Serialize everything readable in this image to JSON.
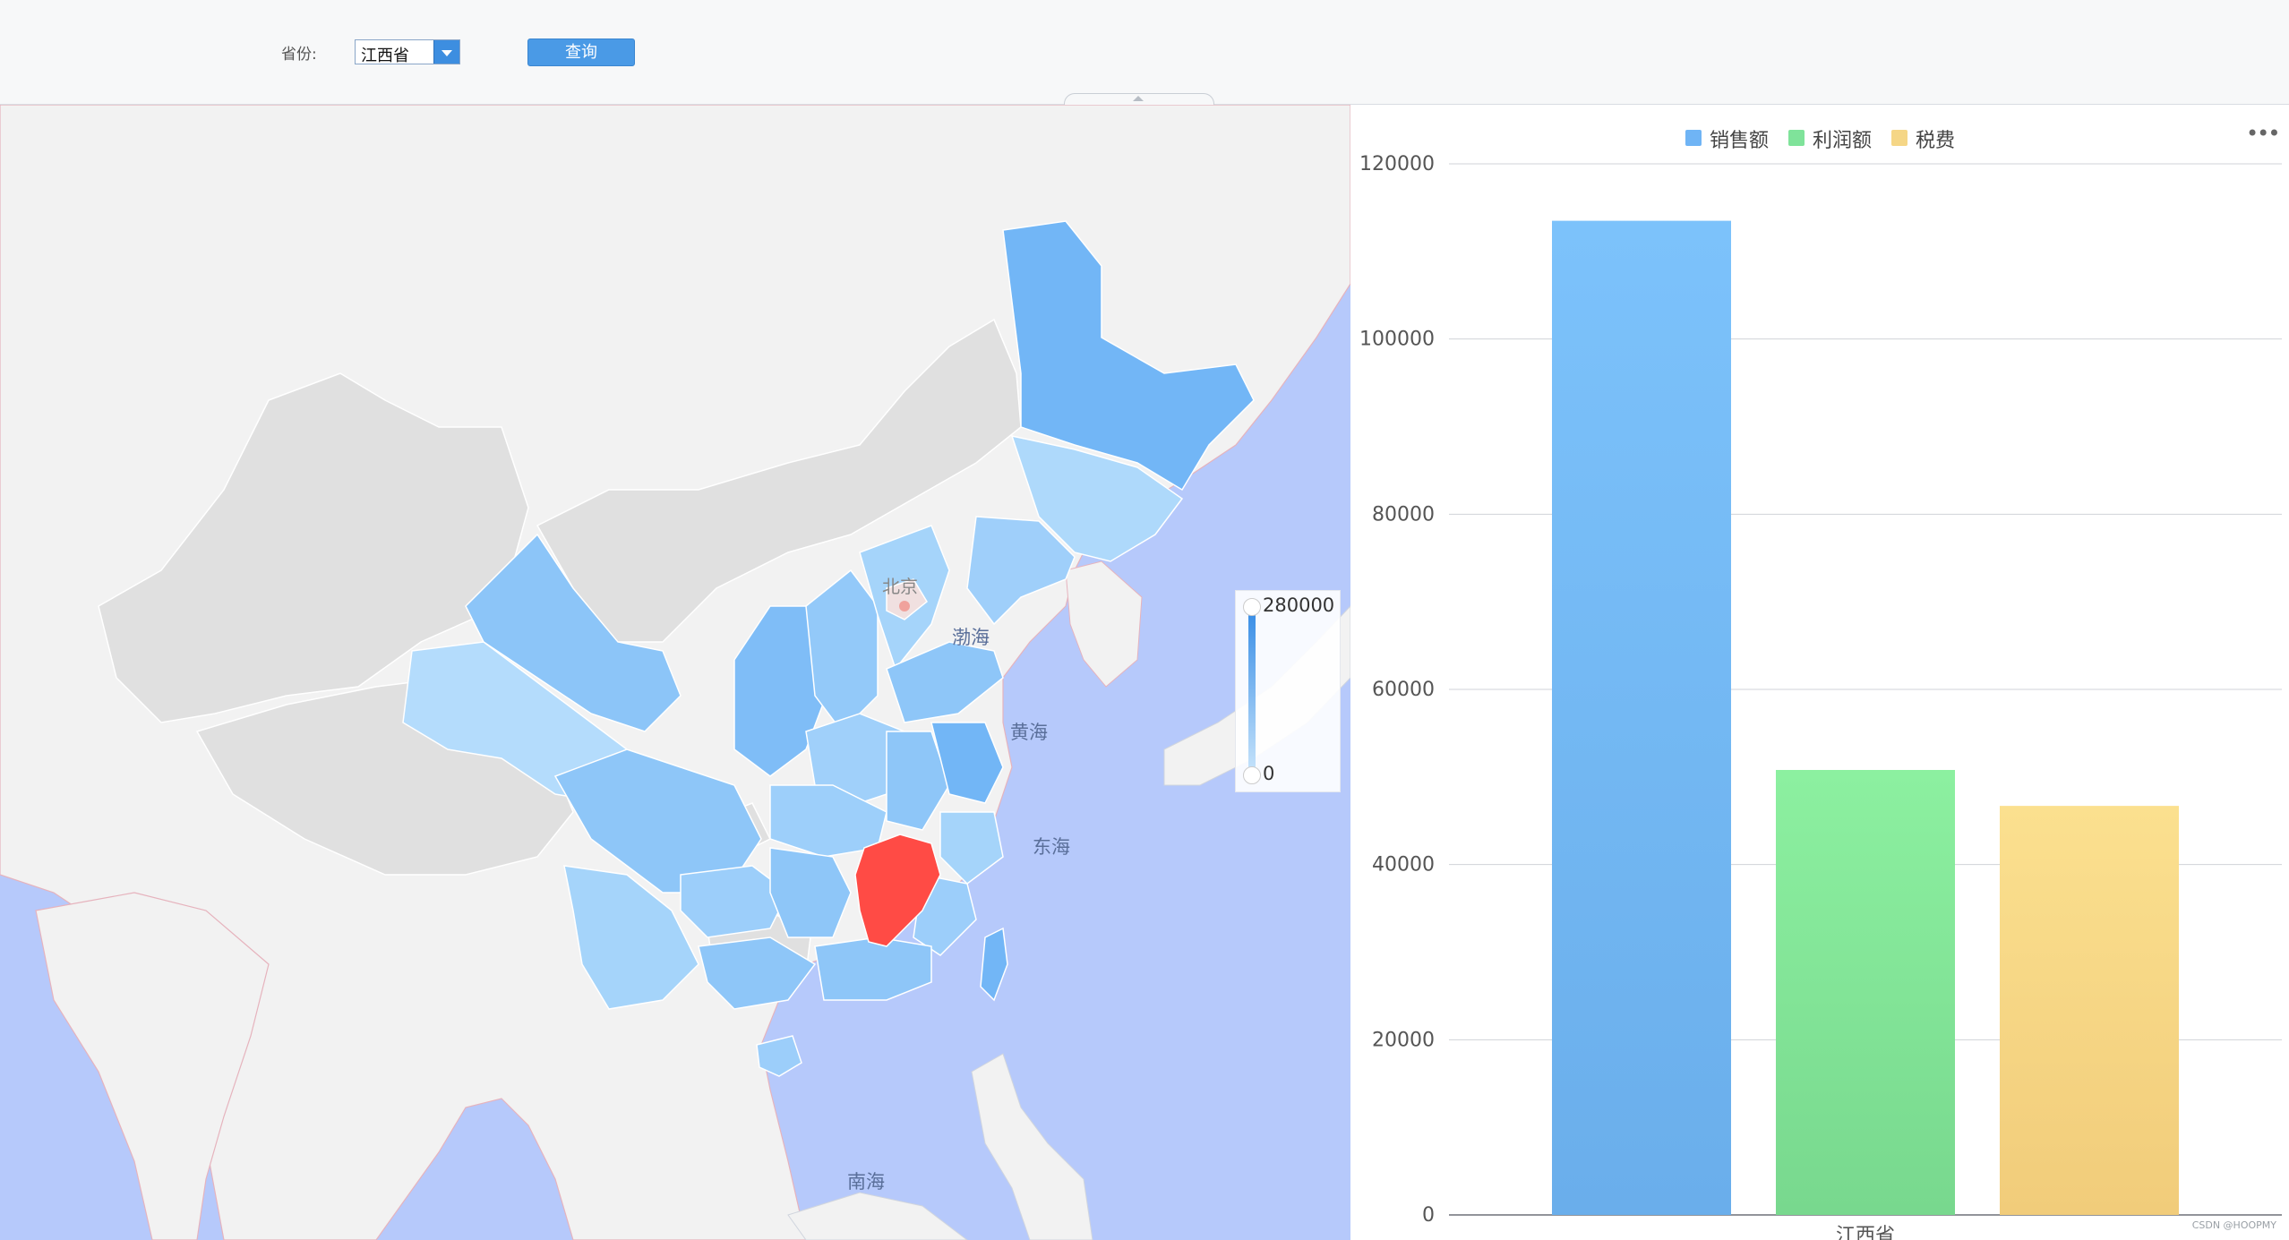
{
  "toolbar": {
    "province_label": "省份:",
    "province_value": "江西省",
    "query_label": "查询"
  },
  "map": {
    "sea_labels": [
      "渤海",
      "黄海",
      "东海",
      "南海"
    ],
    "capital_label": "北京",
    "highlight_color": "#ff4b45",
    "visual_map": {
      "max": "280000",
      "min": "0"
    }
  },
  "chart_data": {
    "type": "bar",
    "categories": [
      "江西省"
    ],
    "series": [
      {
        "name": "销售额",
        "values": [
          113500
        ],
        "color": "#6fb4f5"
      },
      {
        "name": "利润额",
        "values": [
          50800
        ],
        "color": "#7fe39a"
      },
      {
        "name": "税费",
        "values": [
          46700
        ],
        "color": "#f5d686"
      }
    ],
    "ylim": [
      0,
      120000
    ],
    "yticks": [
      "0",
      "20000",
      "40000",
      "60000",
      "80000",
      "100000",
      "120000"
    ],
    "legend_position": "top-center",
    "grid": true
  },
  "watermark": "CSDN @HOOPMY"
}
